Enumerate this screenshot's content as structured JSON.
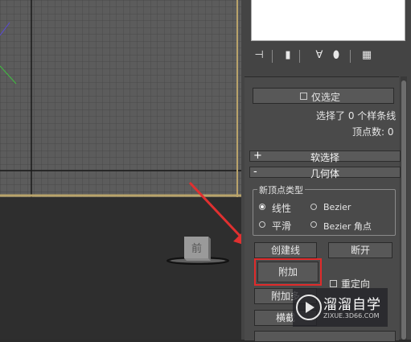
{
  "viewport": {
    "nav_cube_label": "前"
  },
  "panel": {
    "toolbar_icons": [
      "pin-icon",
      "modifier-stack-icon",
      "show-end-result-icon",
      "make-unique-icon",
      "configure-modifier-sets-icon"
    ],
    "selection": {
      "only_selected_label": "仅选定",
      "selected_info": "选择了 0 个样条线",
      "vertex_count": "顶点数: 0"
    },
    "soft_selection": {
      "sign": "+",
      "title": "软选择"
    },
    "geometry": {
      "sign": "-",
      "title": "几何体",
      "new_vertex_type": {
        "title": "新顶点类型",
        "options": [
          "线性",
          "Bezier",
          "平滑",
          "Bezier 角点"
        ],
        "selected": "线性"
      },
      "create_line_label": "创建线",
      "break_label": "断开",
      "attach_label": "附加",
      "reorient_label": "重定向",
      "attach_multiple_label": "附加多",
      "cross_section_label": "横截"
    }
  },
  "watermark": {
    "name": "溜溜自学",
    "url": "ZIXUE.3D66.COM"
  },
  "colors": {
    "highlight": "#e02b2b",
    "arrow": "#e03030"
  }
}
